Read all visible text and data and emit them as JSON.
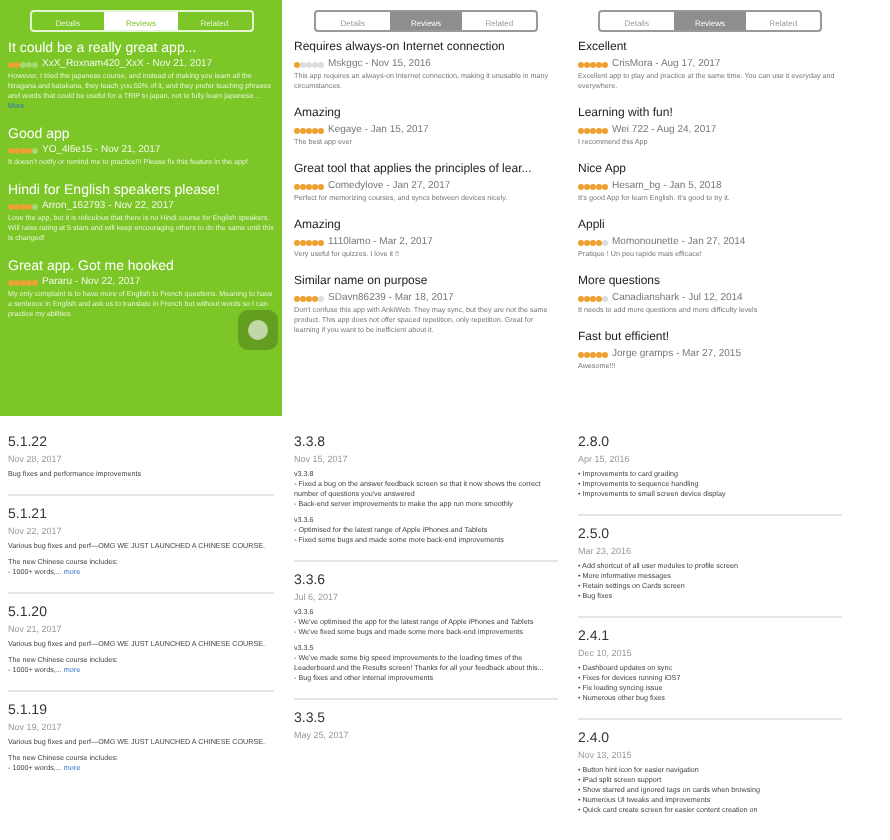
{
  "review_panels": [
    {
      "color": "#7cc628",
      "assistive_button": true,
      "tabs": [
        {
          "label": "Details",
          "selected": false
        },
        {
          "label": "Reviews",
          "selected": true
        },
        {
          "label": "Related",
          "selected": false
        }
      ],
      "reviews": [
        {
          "title": "It could be a really great app...",
          "stars": 2,
          "byline": "XxX_Roxnam420_XxX - Nov 21, 2017",
          "body": "However, I tried the japanese course, and instead of making you learn all the hiragana and katakana, they teach you 50% of it, and they prefer teaching phrases and words that could be useful for a TRIP to japan, not to fully learn japanese...",
          "more": "More"
        },
        {
          "title": "Good app",
          "stars": 4,
          "byline": "YO_4l6e15 - Nov 21, 2017",
          "body": "It doesn't notify or remind me to practice!!! Please fix this feature in the app!"
        },
        {
          "title": "Hindi for English speakers please!",
          "stars": 4,
          "byline": "Arron_162793 - Nov 22, 2017",
          "body": "Love the app, but it is ridiculous that there is no Hindi course for English speakers. Will raise rating at 5 stars and will keep encouraging others to do the same until this is changed!"
        },
        {
          "title": "Great app. Got me hooked",
          "stars": 5,
          "byline": "Pararu - Nov 22, 2017",
          "body": "My only complaint is to have more of English to French questions. Meaning to have a sentence in English and ask us to translate in French but without words so I can practice my abilities"
        }
      ]
    },
    {
      "color": "#ffffff",
      "assistive_button": false,
      "tabs": [
        {
          "label": "Details",
          "selected": false
        },
        {
          "label": "Reviews",
          "selected": true
        },
        {
          "label": "Related",
          "selected": false
        }
      ],
      "reviews": [
        {
          "title": "Requires always-on Internet connection",
          "stars": 1,
          "byline": "Mskggc - Nov 15, 2016",
          "body": "This app requires an always-on Internet connection, making it unusable in many circumstances."
        },
        {
          "title": "Amazing",
          "stars": 5,
          "byline": "Kegaye - Jan 15, 2017",
          "body": "The best app ever"
        },
        {
          "title": "Great tool that applies the principles of lear...",
          "stars": 5,
          "byline": "Comedylove - Jan 27, 2017",
          "body": "Perfect for memorizing courses, and syncs between devices nicely."
        },
        {
          "title": "Amazing",
          "stars": 5,
          "byline": "1110lamo - Mar 2, 2017",
          "body": "Very useful for quizzes. I love it !!"
        },
        {
          "title": "Similar name on purpose",
          "stars": 4,
          "byline": "SDavn86239 - Mar 18, 2017",
          "body": "Don't confuse this app with AnkiWeb. They may sync, but they are not the same product. This app does not offer spaced repetition, only repetition. Great for learning if you want to be inefficient about it."
        }
      ]
    },
    {
      "color": "#ffffff",
      "assistive_button": false,
      "tabs": [
        {
          "label": "Details",
          "selected": false
        },
        {
          "label": "Reviews",
          "selected": true
        },
        {
          "label": "Related",
          "selected": false
        }
      ],
      "reviews": [
        {
          "title": "Excellent",
          "stars": 5,
          "byline": "CrisMora - Aug 17, 2017",
          "body": "Excellent app to play and practice at the same time. You can use it everyday and everywhere."
        },
        {
          "title": "Learning with fun!",
          "stars": 5,
          "byline": "Wei 722 - Aug 24, 2017",
          "body": "I recommend this App"
        },
        {
          "title": "Nice App",
          "stars": 5,
          "byline": "Hesam_bg - Jan 5, 2018",
          "body": "It's good App for learn English. It's good to try it."
        },
        {
          "title": "Appli",
          "stars": 4,
          "byline": "Momonounette - Jan 27, 2014",
          "body": "Pratique ! Un peu rapide mais efficace!"
        },
        {
          "title": "More questions",
          "stars": 4,
          "byline": "Canadianshark - Jul 12, 2014",
          "body": "It needs to add more questions and more difficulty levels"
        },
        {
          "title": "Fast but efficient!",
          "stars": 5,
          "byline": "Jorge gramps - Mar 27, 2015",
          "body": "Awesome!!!"
        }
      ]
    }
  ],
  "version_panels": [
    {
      "versions": [
        {
          "version": "5.1.22",
          "date": "Nov 28, 2017",
          "lines": [
            "Bug fixes and performance improvements"
          ]
        },
        {
          "version": "5.1.21",
          "date": "Nov 22, 2017",
          "lines": [
            "Various bug fixes and perf—OMG WE JUST LAUNCHED A CHINESE COURSE.",
            "The new Chinese course includes:",
            "- 1000+ words,..."
          ],
          "more": "more"
        },
        {
          "version": "5.1.20",
          "date": "Nov 21, 2017",
          "lines": [
            "Various bug fixes and perf—OMG WE JUST LAUNCHED A CHINESE COURSE.",
            "The new Chinese course includes:",
            "- 1000+ words,..."
          ],
          "more": "more"
        },
        {
          "version": "5.1.19",
          "date": "Nov 19, 2017",
          "lines": [
            "Various bug fixes and perf—OMG WE JUST LAUNCHED A CHINESE COURSE.",
            "The new Chinese course includes:",
            "- 1000+ words,..."
          ],
          "more": "more"
        }
      ]
    },
    {
      "versions": [
        {
          "version": "3.3.8",
          "date": "Nov 15, 2017",
          "lines": [
            "v3.3.8",
            "- Fixed a bug on the answer feedback screen so that it now shows the correct number of questions you've answered",
            "- Back-end server improvements to make the app run more smoothly",
            "v3.3.6",
            "- Optimised for the latest range of Apple iPhones and Tablets",
            "- Fixed some bugs and made some more back-end improvements"
          ]
        },
        {
          "version": "3.3.6",
          "date": "Jul 6, 2017",
          "lines": [
            "v3.3.6",
            "- We've optimised the app for the latest range of Apple iPhones and Tablets",
            "- We've fixed some bugs and made some more back-end improvements",
            "v3.3.5",
            "- We've made some big speed improvements to the loading times of the Leaderboard and the Results screen! Thanks for all your feedback about this...",
            "- Bug fixes and other internal improvements"
          ]
        },
        {
          "version": "3.3.5",
          "date": "May 25, 2017"
        }
      ]
    },
    {
      "versions": [
        {
          "version": "2.8.0",
          "date": "Apr 15, 2016",
          "lines": [
            "• Improvements to card grading",
            "• Improvements to sequence handling",
            "• Improvements to small screen device display"
          ]
        },
        {
          "version": "2.5.0",
          "date": "Mar 23, 2016",
          "lines": [
            "• Add shortcut of all user modules to profile screen",
            "• More informative messages",
            "• Retain settings on Cards screen",
            "• Bug fixes"
          ]
        },
        {
          "version": "2.4.1",
          "date": "Dec 10, 2015",
          "lines": [
            "• Dashboard updates on sync",
            "• Fixes for devices running iOS7",
            "• Fix loading syncing issue",
            "• Numerous other bug fixes"
          ]
        },
        {
          "version": "2.4.0",
          "date": "Nov 13, 2015",
          "lines": [
            "• Button hint icon for easier navigation",
            "• iPad split screen support",
            "• Show starred and ignored tags on cards when browsing",
            "• Numerous UI tweaks and improvements",
            "• Quick card create screen for easier content creation on"
          ]
        }
      ]
    }
  ]
}
